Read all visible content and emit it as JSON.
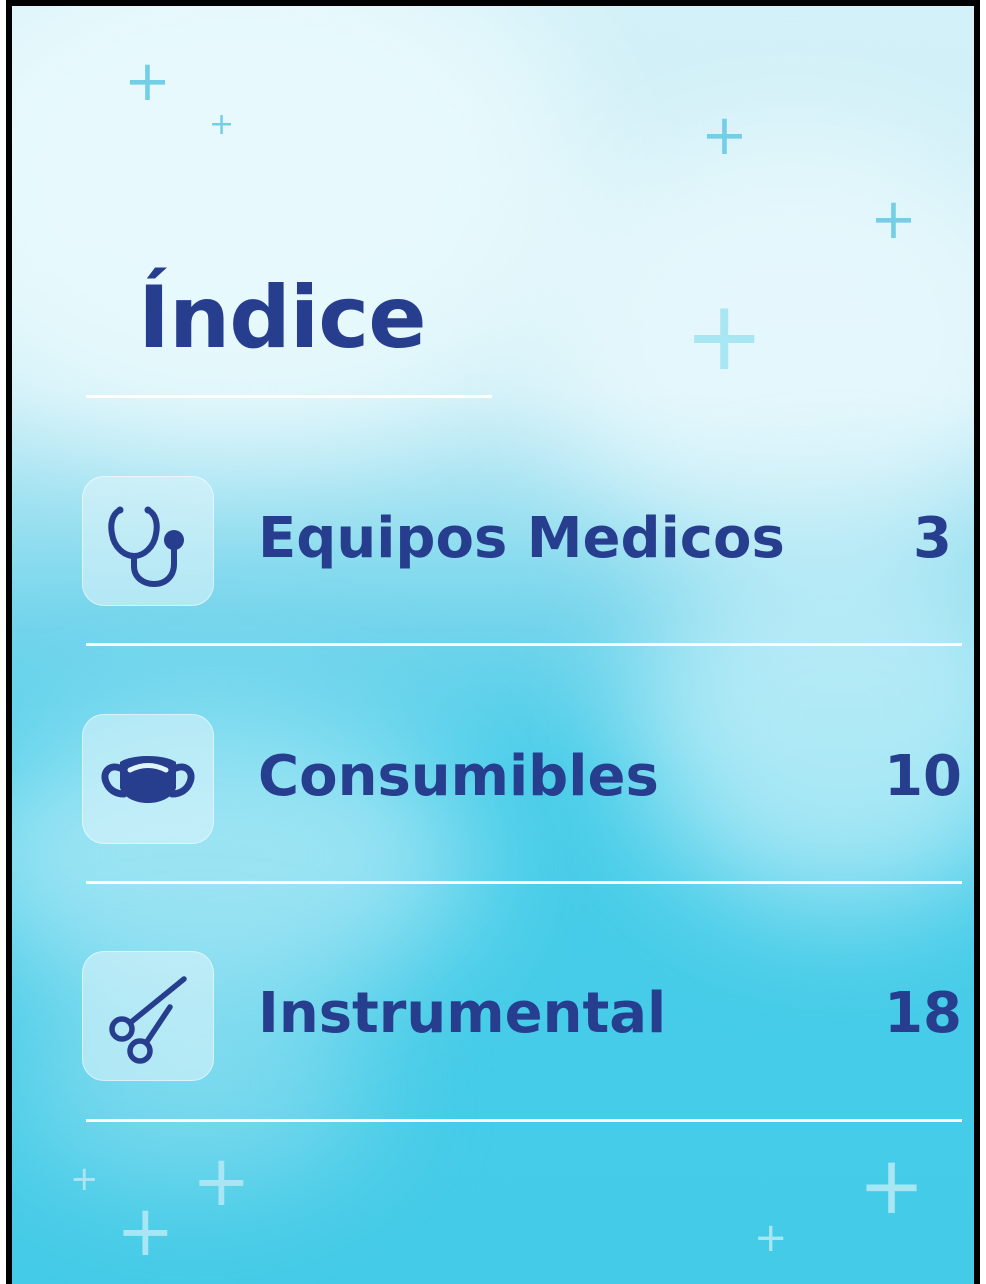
{
  "title": "Índice",
  "entries": [
    {
      "label": "Equipos Medicos",
      "page": "3",
      "icon": "stethoscope-icon"
    },
    {
      "label": "Consumibles",
      "page": "10",
      "icon": "face-mask-icon"
    },
    {
      "label": "Instrumental",
      "page": "18",
      "icon": "scissors-icon"
    }
  ],
  "colors": {
    "text": "#273e8f",
    "accent_cyan": "#44cbe7",
    "light_bg": "#d3f1f8",
    "plus_mark": "#74cfe6",
    "divider": "#ffffff"
  }
}
